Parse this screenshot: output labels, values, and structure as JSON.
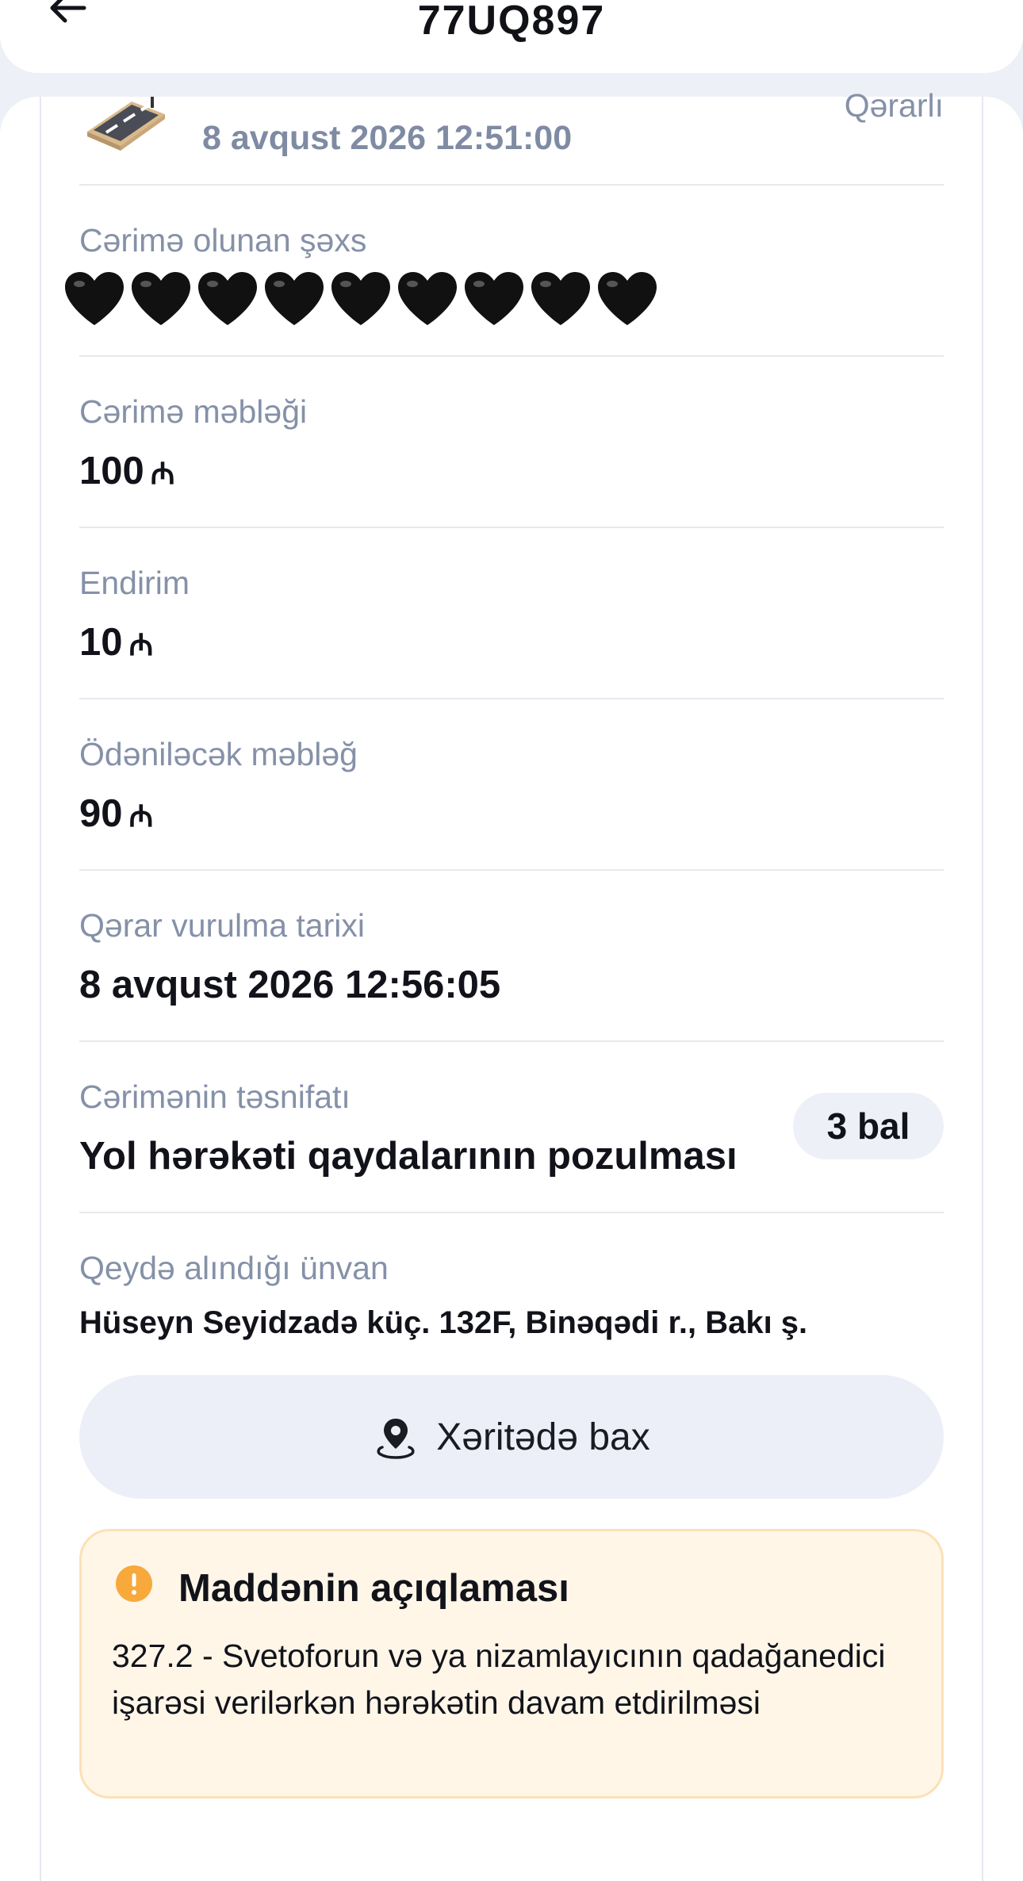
{
  "header": {
    "title": "77UQ897",
    "back_icon": "arrow-left-icon"
  },
  "summary": {
    "icon": "road-icon",
    "date": "8 avqust 2026 12:51:00",
    "status": "Qərarlı"
  },
  "fields": {
    "person": {
      "label": "Cərimə olunan şəxs",
      "masked_icon": "black-heart-icon",
      "masked_count": 9
    },
    "fine_amount": {
      "label": "Cərimə məbləği",
      "value": "100",
      "currency": "₼"
    },
    "discount": {
      "label": "Endirim",
      "value": "10",
      "currency": "₼"
    },
    "payable": {
      "label": "Ödəniləcək məbləğ",
      "value": "90",
      "currency": "₼"
    },
    "decision_date": {
      "label": "Qərar vurulma tarixi",
      "value": "8 avqust 2026 12:56:05"
    },
    "classification": {
      "label": "Cərimənin təsnifatı",
      "value": "Yol hərəkəti qaydalarının pozulması",
      "points": "3 bal"
    },
    "address": {
      "label": "Qeydə alındığı ünvan",
      "value": "Hüseyn Seyidzadə küç. 132F, Binəqədi r., Bakı ş."
    }
  },
  "map_button": {
    "label": "Xəritədə bax",
    "icon": "map-pin-icon"
  },
  "article": {
    "title": "Maddənin açıqlaması",
    "icon": "warning-icon",
    "text": "327.2 - Svetoforun və ya nizamlayıcının qadağanedici işarəsi verilərkən hərəkətin davam etdirilməsi"
  },
  "colors": {
    "background": "#eef0f8",
    "card": "#ffffff",
    "label": "#8591a8",
    "text": "#12131a",
    "warning_bg": "#fff6e8",
    "warning_border": "#fbe1b6",
    "warning_icon": "#f7a93b"
  }
}
